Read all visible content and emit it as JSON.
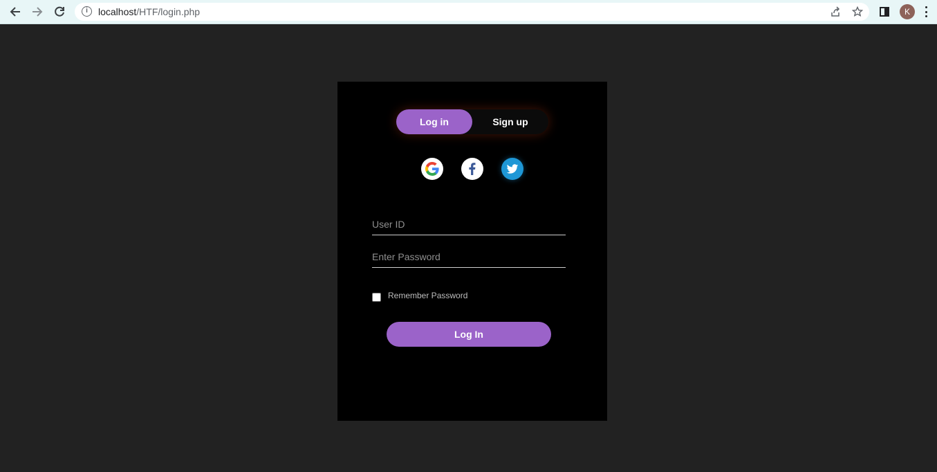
{
  "browser": {
    "url_host": "localhost",
    "url_path": "/HTF/login.php",
    "avatar_initial": "K",
    "icons": [
      "back-arrow-icon",
      "forward-arrow-icon",
      "reload-icon",
      "info-icon",
      "share-icon",
      "star-icon",
      "side-panel-icon",
      "menu-dots-icon"
    ]
  },
  "login": {
    "tabs": {
      "active_label": "Log in",
      "other_label": "Sign up"
    },
    "social_icons": [
      "google-icon",
      "facebook-icon",
      "twitter-icon"
    ],
    "user_id_placeholder": "User ID",
    "password_placeholder": "Enter Password",
    "remember_label": "Remember Password",
    "remember_checked": false,
    "submit_label": "Log In"
  },
  "colors": {
    "page_background": "#222222",
    "card_background": "#000000",
    "accent": "#9b63c9"
  }
}
